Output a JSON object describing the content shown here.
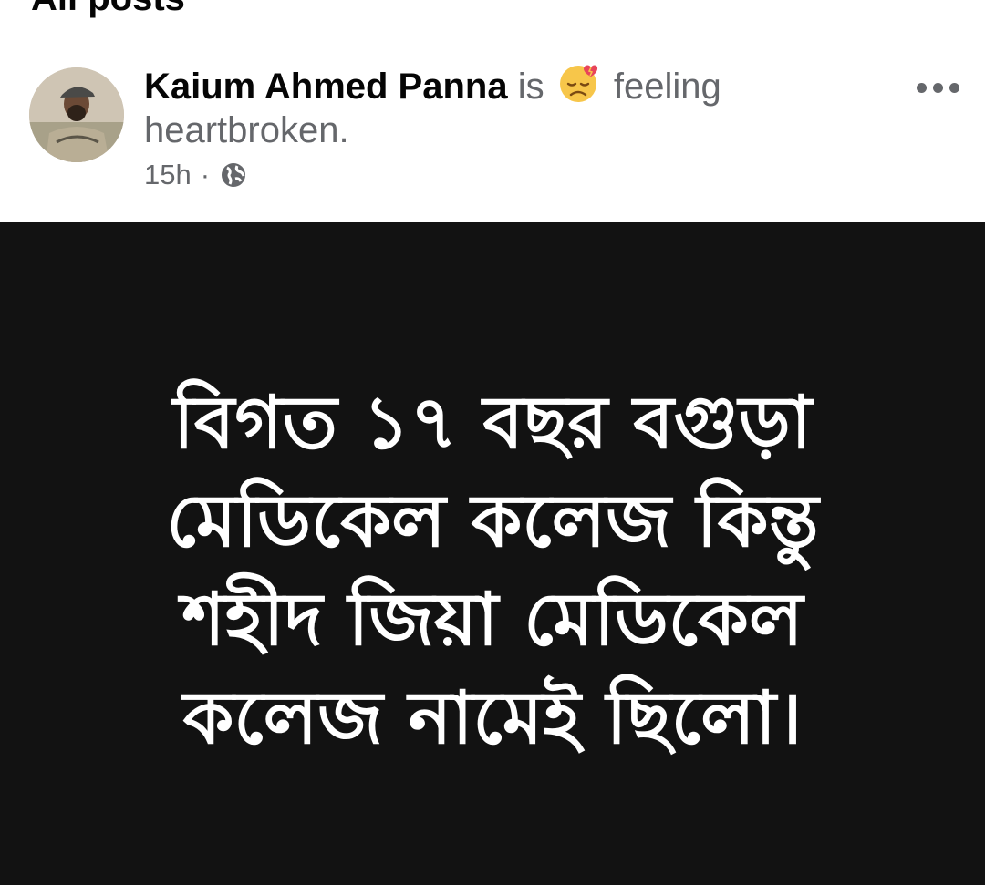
{
  "section": {
    "title": "All posts"
  },
  "post": {
    "author": "Kaium Ahmed Panna",
    "is_word": "is",
    "feeling_icon": "heartbroken-emoji",
    "feeling_word": "feeling",
    "feeling_value": "heartbroken.",
    "time": "15h",
    "separator": "·",
    "audience_icon": "globe-icon",
    "image_text_lines": [
      "বিগত ১৭ বছর বগুড়া",
      "মেডিকেল কলেজ কিন্তু",
      "শহীদ জিয়া মেডিকেল",
      "কলেজ নামেই ছিলো।"
    ],
    "colors": {
      "author": "#050505",
      "secondary": "#65676b",
      "image_background": "#121212",
      "image_text": "#ffffff"
    }
  }
}
